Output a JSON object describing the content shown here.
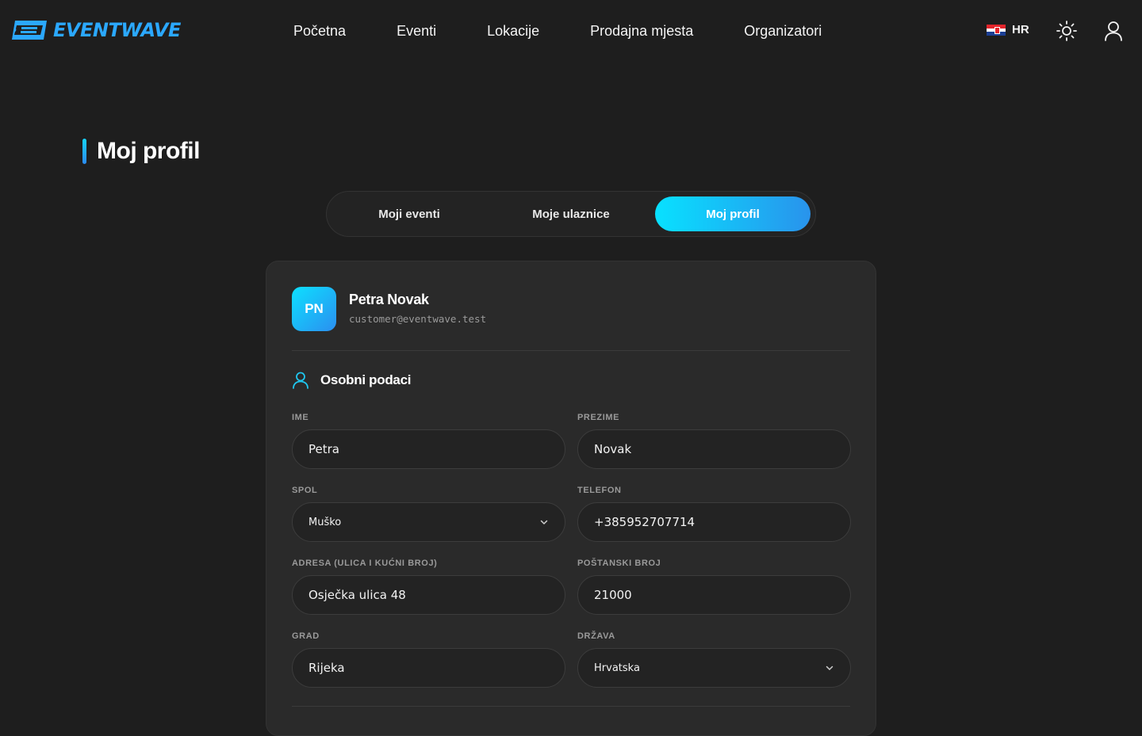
{
  "brand": {
    "name": "EVENTWAVE",
    "accent": "#2ba8ff"
  },
  "nav": {
    "links": [
      "Početna",
      "Eventi",
      "Lokacije",
      "Prodajna mjesta",
      "Organizatori"
    ],
    "language": "HR"
  },
  "page": {
    "title": "Moj profil"
  },
  "tabs": [
    {
      "label": "Moji eventi",
      "active": false
    },
    {
      "label": "Moje ulaznice",
      "active": false
    },
    {
      "label": "Moj profil",
      "active": true
    }
  ],
  "profile": {
    "initials": "PN",
    "name": "Petra Novak",
    "email": "customer@eventwave.test"
  },
  "personal": {
    "section_title": "Osobni podaci",
    "fields": {
      "ime": {
        "label": "IME",
        "value": "Petra"
      },
      "prezime": {
        "label": "PREZIME",
        "value": "Novak"
      },
      "spol": {
        "label": "SPOL",
        "value": "Muško"
      },
      "telefon": {
        "label": "TELEFON",
        "value": "+385952707714"
      },
      "adresa": {
        "label": "ADRESA (ULICA I KUĆNI BROJ)",
        "value": "Osječka ulica 48"
      },
      "postanski": {
        "label": "POŠTANSKI BROJ",
        "value": "21000"
      },
      "grad": {
        "label": "GRAD",
        "value": "Rijeka"
      },
      "drzava": {
        "label": "DRŽAVA",
        "value": "Hrvatska"
      }
    }
  },
  "colors": {
    "background": "#1e1e1e",
    "card": "#2a2a2a",
    "gradient_start": "#08e1ff",
    "gradient_end": "#2993ec"
  }
}
